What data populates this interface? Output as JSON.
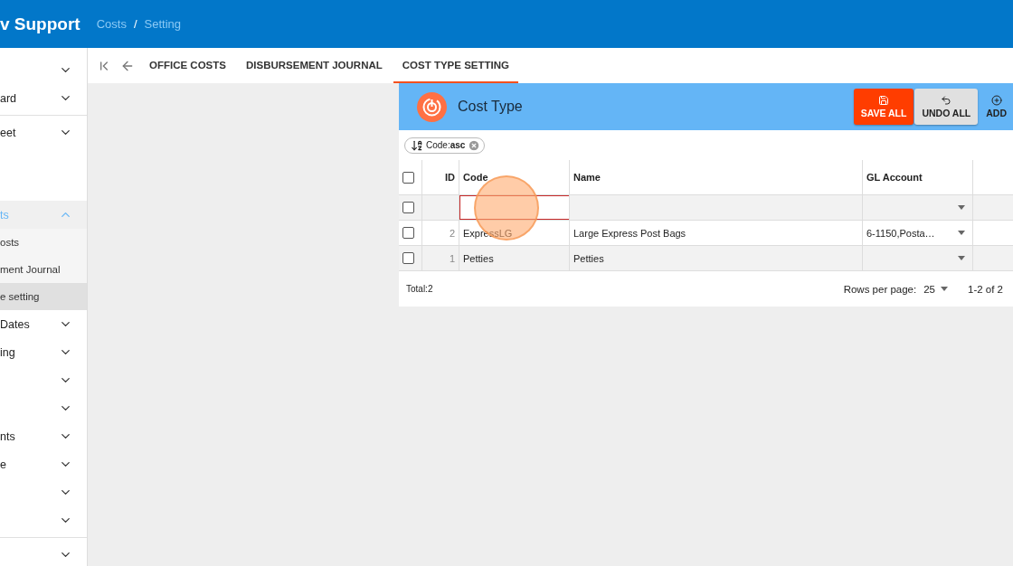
{
  "header": {
    "title": "v Support",
    "breadcrumb": [
      "Costs",
      "Setting"
    ],
    "separator": "/"
  },
  "sidebar": {
    "groups": [
      {
        "items": [
          {
            "expanded": false,
            "selected": false
          },
          {
            "label": "ard",
            "expanded": false,
            "selected": false
          }
        ]
      },
      {
        "items": [
          {
            "label": "eet",
            "expanded": false,
            "selected": false
          },
          {
            "kind": "spacer"
          },
          {
            "label": "ts",
            "expanded": true,
            "selected": true,
            "children": [
              {
                "label": "osts",
                "selected": false
              },
              {
                "label": "ment Journal",
                "selected": false
              },
              {
                "label": "e setting",
                "selected": true
              }
            ]
          },
          {
            "label": "Dates",
            "expanded": false,
            "selected": false
          },
          {
            "label": "ing",
            "expanded": false,
            "selected": false
          },
          {
            "expanded": false,
            "selected": false
          },
          {
            "expanded": false,
            "selected": false
          },
          {
            "label": "nts",
            "expanded": false,
            "selected": false
          },
          {
            "label": "e",
            "expanded": false,
            "selected": false
          },
          {
            "expanded": false,
            "selected": false
          },
          {
            "expanded": false,
            "selected": false
          }
        ]
      },
      {
        "items": [
          {
            "expanded": false,
            "selected": false
          }
        ]
      }
    ]
  },
  "tabs": [
    {
      "label": "OFFICE COSTS",
      "selected": false
    },
    {
      "label": "DISBURSEMENT JOURNAL",
      "selected": false
    },
    {
      "label": "COST TYPE SETTING",
      "selected": true
    }
  ],
  "panel": {
    "title": "Cost Type",
    "buttons": [
      {
        "label": "SAVE ALL",
        "kind": "save"
      },
      {
        "label": "UNDO ALL",
        "kind": "undo"
      },
      {
        "label": "ADD",
        "kind": "add"
      }
    ],
    "sort_chip": {
      "label": "Code:",
      "value": "asc"
    },
    "table": {
      "columns": [
        "ID",
        "Code",
        "Name",
        "GL Account"
      ],
      "select_all": {
        "checked": false
      },
      "new_row": {
        "checked": false
      },
      "rows": [
        {
          "id": "2",
          "code": "ExpressLG",
          "name": "Large Express Post Bags",
          "gl_account": "6-1150,Posta…",
          "checked": false
        },
        {
          "id": "1",
          "code": "Petties",
          "name": "Petties",
          "checked": false
        }
      ]
    },
    "footer": {
      "total": "Total:2",
      "rows_per_page_label": "Rows per page:",
      "rows_per_page": "25",
      "range": "1-2 of 2"
    }
  },
  "click_indicator": true
}
